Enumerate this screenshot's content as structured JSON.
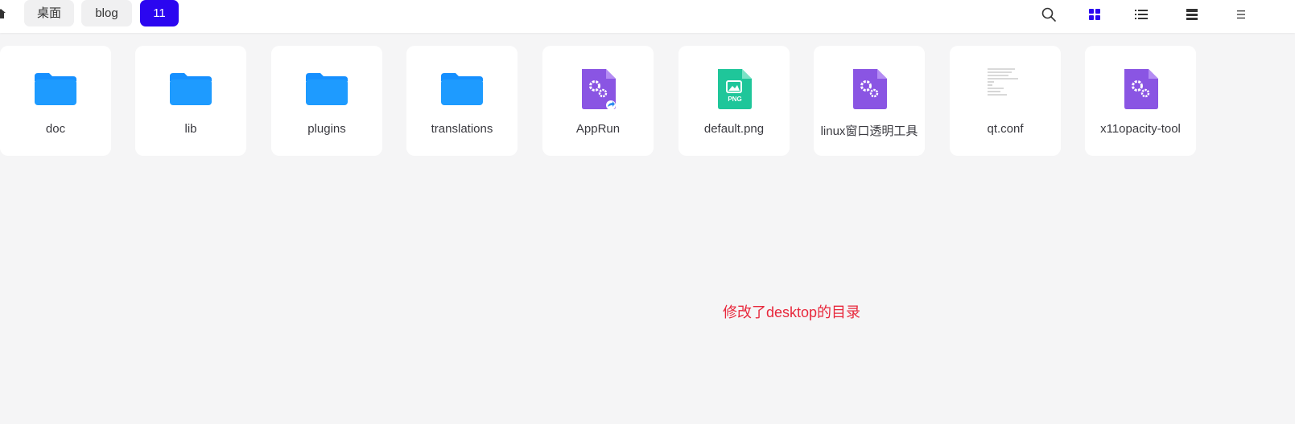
{
  "breadcrumb": {
    "items": [
      {
        "label": "桌面",
        "active": false
      },
      {
        "label": "blog",
        "active": false
      },
      {
        "label": "11",
        "active": true
      }
    ]
  },
  "toolbar": {
    "icons": [
      "search-icon",
      "grid-view-icon",
      "list-view-icon",
      "detail-view-icon",
      "menu-icon"
    ],
    "accent": "#2b06f0"
  },
  "files": [
    {
      "name": "doc",
      "kind": "folder"
    },
    {
      "name": "lib",
      "kind": "folder"
    },
    {
      "name": "plugins",
      "kind": "folder"
    },
    {
      "name": "translations",
      "kind": "folder"
    },
    {
      "name": "AppRun",
      "kind": "executable-link"
    },
    {
      "name": "default.png",
      "kind": "png-image"
    },
    {
      "name": "linux窗口透明工具",
      "kind": "executable"
    },
    {
      "name": "qt.conf",
      "kind": "text"
    },
    {
      "name": "x11opacity-tool",
      "kind": "executable"
    }
  ],
  "qt_conf_preview": "",
  "note": "修改了desktop的目录",
  "colors": {
    "folder": "#1e9bff",
    "executable": "#8a55e3",
    "png": "#1fc69a",
    "note": "#e8283c"
  }
}
